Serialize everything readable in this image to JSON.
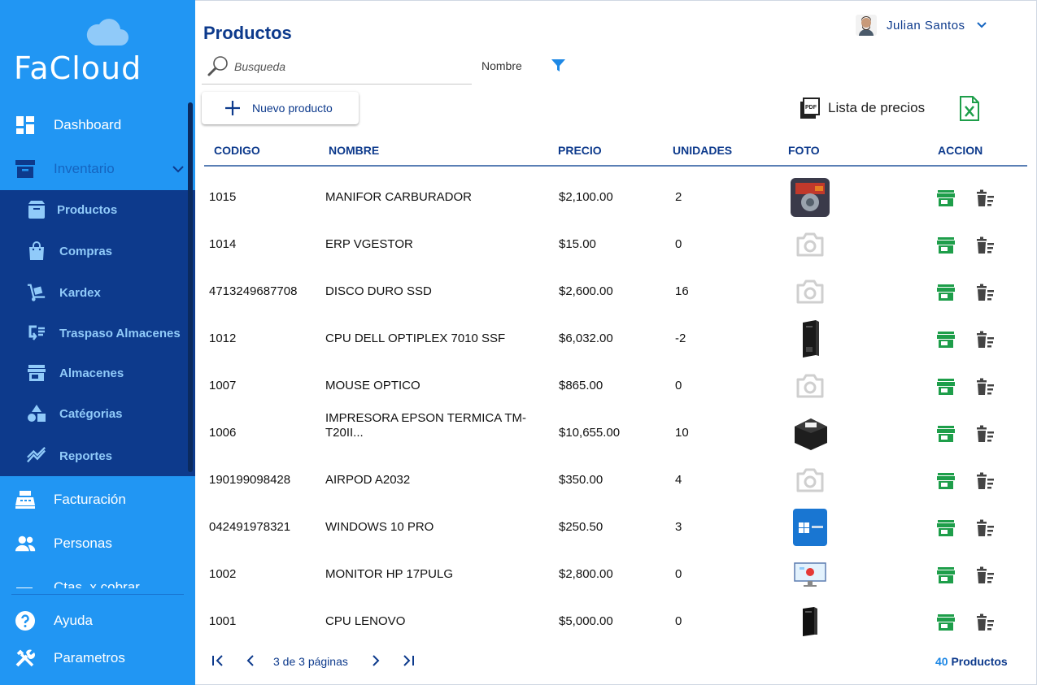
{
  "app": {
    "logo_text": "FaCloud"
  },
  "sidebar": {
    "items": [
      {
        "label": "Dashboard",
        "icon": "dashboard-icon"
      },
      {
        "label": "Inventario",
        "icon": "archive-icon"
      },
      {
        "label": "Facturación",
        "icon": "cash-register-icon"
      },
      {
        "label": "Personas",
        "icon": "people-icon"
      },
      {
        "label": "Ctas. x cobrar",
        "icon": "accounts-receivable-icon"
      },
      {
        "label": "Ayuda",
        "icon": "help-icon"
      },
      {
        "label": "Parametros",
        "icon": "tools-icon"
      }
    ],
    "submenu": [
      {
        "label": "Productos",
        "icon": "box-icon"
      },
      {
        "label": "Compras",
        "icon": "shopping-bag-icon"
      },
      {
        "label": "Kardex",
        "icon": "hand-truck-icon"
      },
      {
        "label": "Traspaso Almacenes",
        "icon": "transfer-icon"
      },
      {
        "label": "Almacenes",
        "icon": "store-icon"
      },
      {
        "label": "Catégorias",
        "icon": "shapes-icon"
      },
      {
        "label": "Reportes",
        "icon": "trend-icon"
      }
    ]
  },
  "header": {
    "title": "Productos",
    "user_name": "Julian Santos"
  },
  "search": {
    "placeholder": "Busqueda",
    "value": ""
  },
  "filter": {
    "label": "Nombre"
  },
  "toolbar": {
    "new_product": "Nuevo producto",
    "price_list": "Lista de precios"
  },
  "table": {
    "columns": [
      "CODIGO",
      "NOMBRE",
      "PRECIO",
      "UNIDADES",
      "FOTO",
      "ACCION"
    ],
    "rows": [
      {
        "code": "1015",
        "name": "MANIFOR CARBURADOR",
        "price": "$2,100.00",
        "units": "2",
        "photo": "carburetor"
      },
      {
        "code": "1014",
        "name": "ERP VGESTOR",
        "price": "$15.00",
        "units": "0",
        "photo": "none"
      },
      {
        "code": "4713249687708",
        "name": "DISCO DURO SSD",
        "price": "$2,600.00",
        "units": "16",
        "photo": "none"
      },
      {
        "code": "1012",
        "name": "CPU DELL OPTIPLEX  7010 SSF",
        "price": "$6,032.00",
        "units": "-2",
        "photo": "cpu-tower"
      },
      {
        "code": "1007",
        "name": "MOUSE OPTICO",
        "price": "$865.00",
        "units": "0",
        "photo": "none"
      },
      {
        "code": "1006",
        "name": "IMPRESORA EPSON TERMICA TM-T20II...",
        "price": "$10,655.00",
        "units": "10",
        "photo": "thermal-printer"
      },
      {
        "code": "190199098428",
        "name": "AIRPOD A2032",
        "price": "$350.00",
        "units": "4",
        "photo": "none"
      },
      {
        "code": "042491978321",
        "name": "WINDOWS 10 PRO",
        "price": "$250.50",
        "units": "3",
        "photo": "windows-box"
      },
      {
        "code": "1002",
        "name": "MONITOR HP 17PULG",
        "price": "$2,800.00",
        "units": "0",
        "photo": "monitor"
      },
      {
        "code": "1001",
        "name": "CPU LENOVO",
        "price": "$5,000.00",
        "units": "0",
        "photo": "small-tower"
      }
    ]
  },
  "pagination": {
    "text": "3 de 3 páginas",
    "count": "40",
    "count_label": "Productos"
  },
  "colors": {
    "sidebar_bg": "#2196f3",
    "submenu_bg": "#0d3a8c",
    "primary_text": "#0d3a8c",
    "action_green": "#1e9e4a",
    "action_gray": "#444444"
  }
}
